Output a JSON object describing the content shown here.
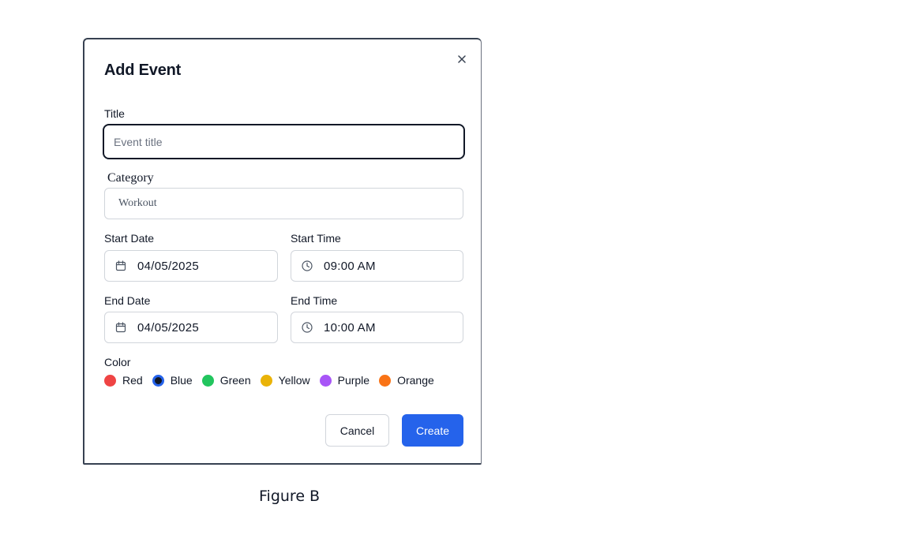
{
  "dialog": {
    "title": "Add Event",
    "close_icon": "close-icon"
  },
  "form": {
    "title_label": "Title",
    "title_placeholder": "Event title",
    "title_value": "",
    "category_label": "Category",
    "category_value": "Workout",
    "start_date_label": "Start Date",
    "start_date_value": "04/05/2025",
    "start_time_label": "Start Time",
    "start_time_value": "09:00 AM",
    "end_date_label": "End Date",
    "end_date_value": "04/05/2025",
    "end_time_label": "End Time",
    "end_time_value": "10:00 AM",
    "color_label": "Color",
    "colors": [
      {
        "name": "Red",
        "hex": "#ef4444",
        "selected": false
      },
      {
        "name": "Blue",
        "hex": "#2563eb",
        "selected": true
      },
      {
        "name": "Green",
        "hex": "#22c55e",
        "selected": false
      },
      {
        "name": "Yellow",
        "hex": "#eab308",
        "selected": false
      },
      {
        "name": "Purple",
        "hex": "#a855f7",
        "selected": false
      },
      {
        "name": "Orange",
        "hex": "#f97316",
        "selected": false
      }
    ]
  },
  "actions": {
    "cancel_label": "Cancel",
    "create_label": "Create",
    "primary_color": "#2563eb"
  },
  "caption": "Figure B"
}
